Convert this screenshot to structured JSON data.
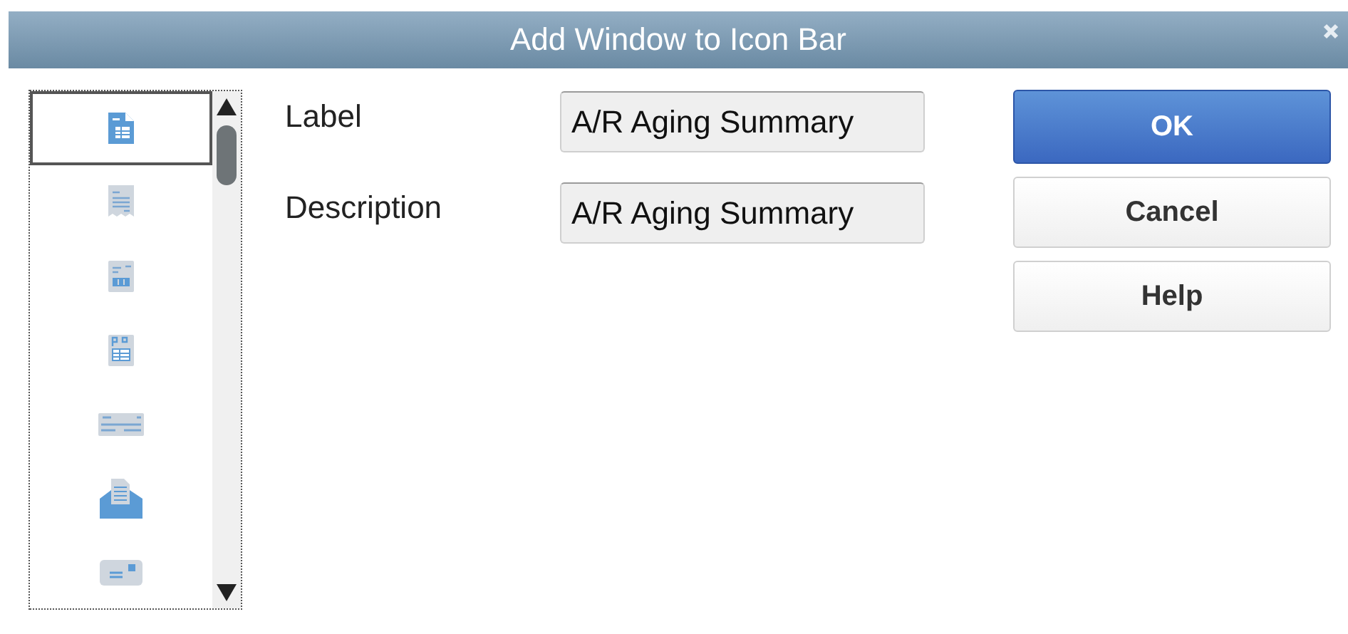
{
  "window": {
    "title": "Add Window to Icon Bar"
  },
  "icon_list": {
    "items": [
      {
        "kind": "document",
        "selected": true
      },
      {
        "kind": "receipt",
        "selected": false
      },
      {
        "kind": "statement",
        "selected": false
      },
      {
        "kind": "purchase-order",
        "selected": false
      },
      {
        "kind": "check",
        "selected": false
      },
      {
        "kind": "inbox",
        "selected": false
      },
      {
        "kind": "card",
        "selected": false
      }
    ]
  },
  "fields": [
    {
      "label": "Label",
      "value": "A/R Aging Summary"
    },
    {
      "label": "Description",
      "value": "A/R Aging Summary"
    }
  ],
  "buttons": [
    {
      "label": "OK",
      "kind": "primary"
    },
    {
      "label": "Cancel",
      "kind": "normal"
    },
    {
      "label": "Help",
      "kind": "normal"
    }
  ]
}
